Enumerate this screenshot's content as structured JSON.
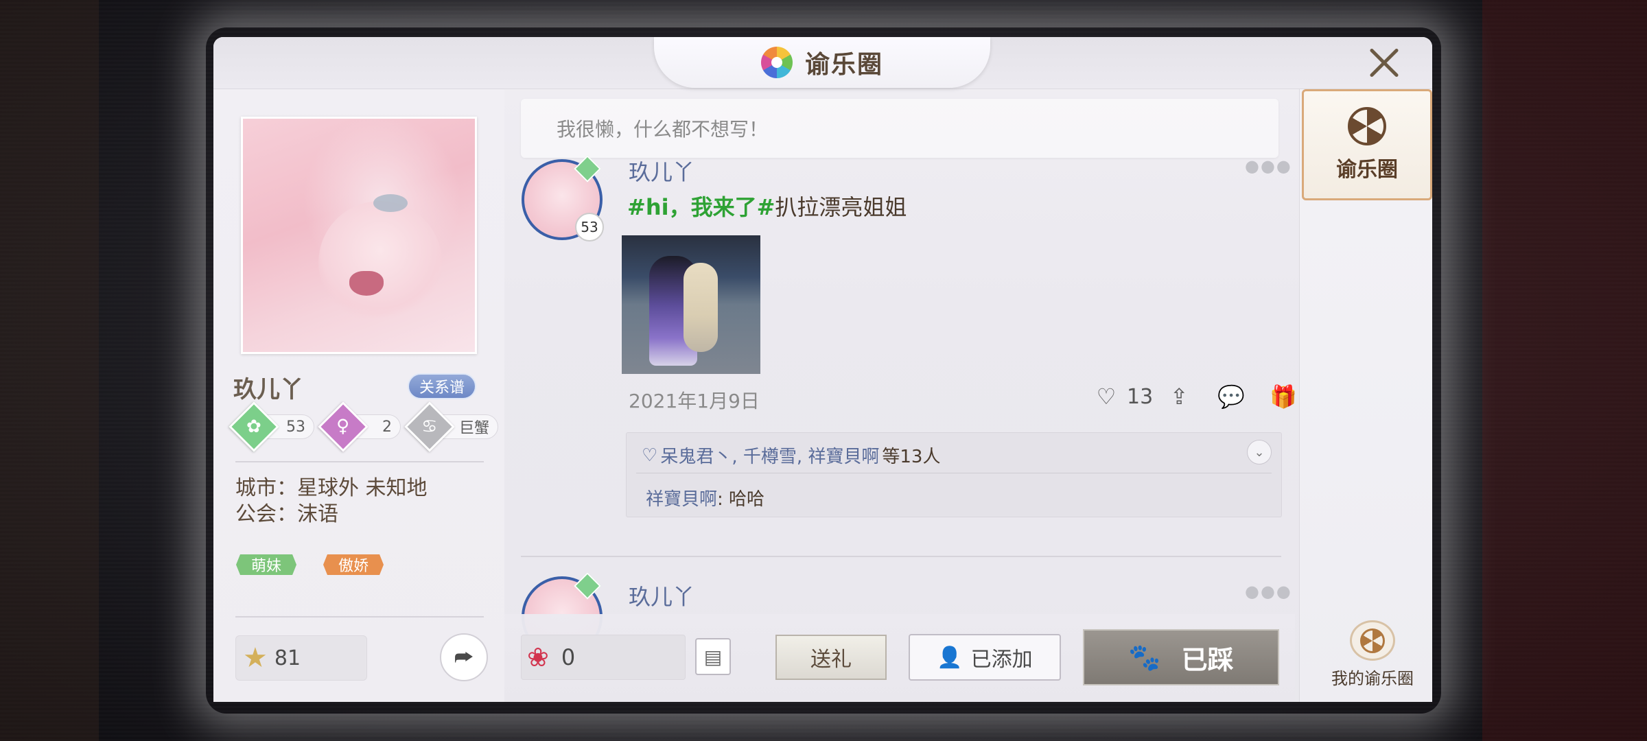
{
  "window": {
    "title": "谕乐圈"
  },
  "profile": {
    "name": "玖儿丫",
    "relation_button": "关系谱",
    "level": "53",
    "gender_count": "2",
    "zodiac": "巨蟹",
    "city_label": "城市：",
    "city_value": "星球外 未知地",
    "guild_label": "公会：",
    "guild_value": "沫语",
    "tags": [
      "萌妹",
      "傲娇"
    ],
    "stars": "81"
  },
  "feed": {
    "status_text": "我很懒，什么都不想写！",
    "posts": [
      {
        "author": "玖儿丫",
        "avatar_level": "53",
        "topic": "#hi，我来了#",
        "text": "扒拉漂亮姐姐",
        "date": "2021年1月9日",
        "like_count": "13",
        "likers_names": "呆鬼君丶, 千樽雪, 祥寶貝啊",
        "likers_suffix": "等13人",
        "comment_author": "祥寶貝啊",
        "comment_sep": ":",
        "comment_text": " 哈哈"
      },
      {
        "author": "玖儿丫"
      }
    ]
  },
  "bottom_bar": {
    "flowers": "0",
    "gift_button": "送礼",
    "added_button": "已添加",
    "stepped_button": "已踩"
  },
  "sidebar": {
    "active_tab": "谕乐圈",
    "my_circle": "我的谕乐圈"
  },
  "colors": {
    "accent_brown": "#5a4838",
    "link_blue": "#5a6c9a",
    "topic_green": "#2ea234",
    "tag_green": "#7dc57a",
    "tag_orange": "#e8904e"
  }
}
